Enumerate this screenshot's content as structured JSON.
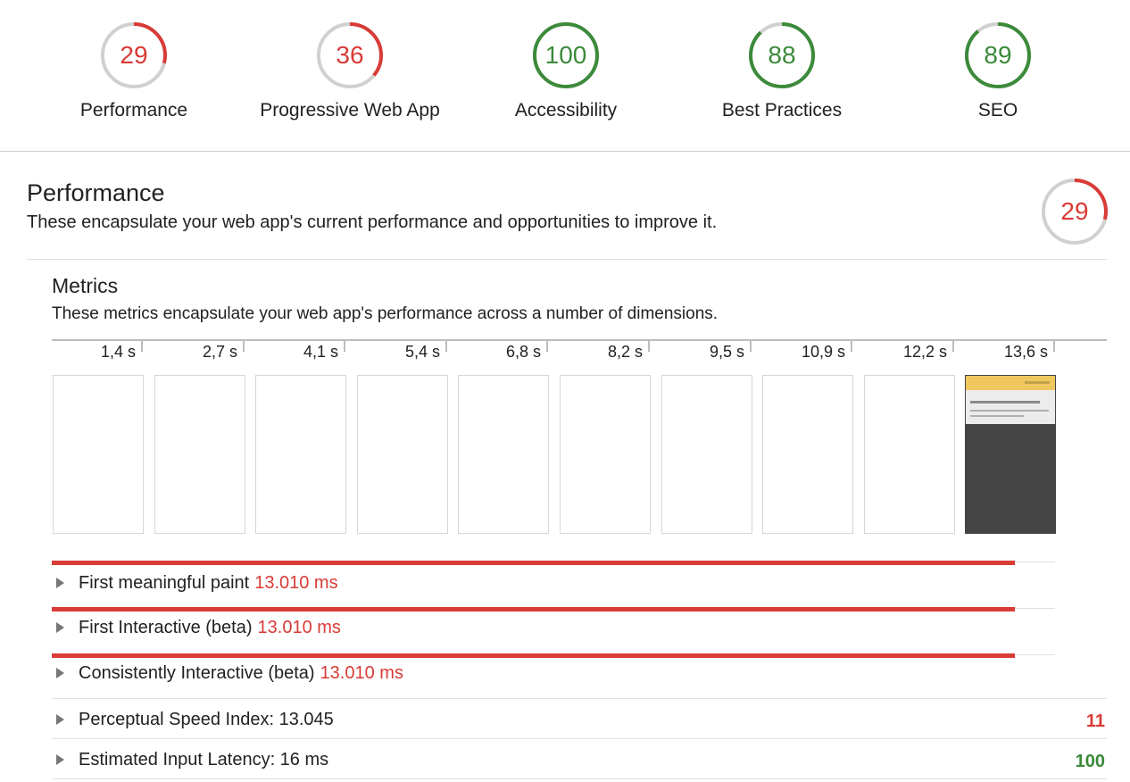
{
  "colors": {
    "fail": "#d93b36",
    "pass": "#3c8a3a",
    "track": "#d0d0d0"
  },
  "categories": [
    {
      "label": "Performance",
      "score": 29,
      "status": "fail"
    },
    {
      "label": "Progressive Web App",
      "score": 36,
      "status": "fail"
    },
    {
      "label": "Accessibility",
      "score": 100,
      "status": "pass"
    },
    {
      "label": "Best Practices",
      "score": 88,
      "status": "pass"
    },
    {
      "label": "SEO",
      "score": 89,
      "status": "pass"
    }
  ],
  "performance": {
    "title": "Performance",
    "description": "These encapsulate your web app's current performance and opportunities to improve it.",
    "score": 29
  },
  "metrics": {
    "title": "Metrics",
    "description": "These metrics encapsulate your web app's performance across a number of dimensions.",
    "filmstrip": [
      "1,4 s",
      "2,7 s",
      "4,1 s",
      "5,4 s",
      "6,8 s",
      "8,2 s",
      "9,5 s",
      "10,9 s",
      "12,2 s",
      "13,6 s"
    ],
    "timed": [
      {
        "label": "First meaningful paint",
        "value": "13.010 ms",
        "fraction": 0.96
      },
      {
        "label": "First Interactive (beta)",
        "value": "13.010 ms",
        "fraction": 0.96
      },
      {
        "label": "Consistently Interactive (beta)",
        "value": "13.010 ms",
        "fraction": 0.96
      }
    ],
    "scored": [
      {
        "label": "Perceptual Speed Index: 13.045",
        "score": "11",
        "status": "fail"
      },
      {
        "label": "Estimated Input Latency: 16 ms",
        "score": "100",
        "status": "pass"
      }
    ]
  }
}
